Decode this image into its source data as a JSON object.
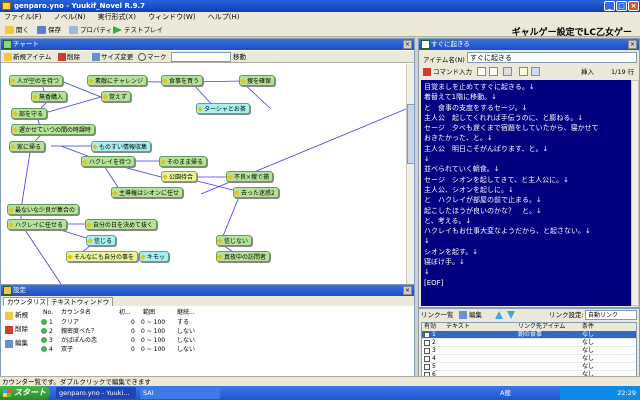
{
  "window": {
    "title": "genparo.yno - Yuukif_Novel R.9.7"
  },
  "menu": [
    "ファイル(F)",
    "ノベル(N)",
    "実行形式(X)",
    "ウィンドウ(W)",
    "ヘルプ(H)"
  ],
  "toolbar": [
    "開く",
    "保存",
    "プロパティ",
    "テストプレイ"
  ],
  "brand": "ギャルゲー設定でLC乙女ゲー",
  "chart": {
    "title": "チャート",
    "tools": [
      "新規アイテム",
      "削除",
      "サイズ変更",
      "マーク",
      "移動"
    ],
    "nodes": [
      {
        "label": "人が空のを待つ"
      },
      {
        "label": "素敵にチャレンジ"
      },
      {
        "label": "食事を買う"
      },
      {
        "label": "捜を確保"
      },
      {
        "label": "無香購入"
      },
      {
        "label": "覚えず"
      },
      {
        "label": "ターシャとお茶"
      },
      {
        "label": "部を守る"
      },
      {
        "label": "遅かせていつの間の時課時"
      },
      {
        "label": "家に帰る"
      },
      {
        "label": "ものすい情報収集"
      },
      {
        "label": "ハクレイを待つ"
      },
      {
        "label": "そのまま帰る"
      },
      {
        "label": "公園待合"
      },
      {
        "label": "不良×捜で捕"
      },
      {
        "label": "主導権はシオンに任せ"
      },
      {
        "label": "去った迷惑2"
      },
      {
        "label": "最ないな少良が集合の"
      },
      {
        "label": "ハクレイに任せる"
      },
      {
        "label": "自分の日を決めて抜く"
      },
      {
        "label": "信じる"
      },
      {
        "label": "信じない"
      },
      {
        "label": "そんなにも自分の事を"
      },
      {
        "label": "キモッ"
      },
      {
        "label": "真夜中の訪問者"
      }
    ]
  },
  "variables": {
    "title": "設定",
    "tabs": [
      "カウンタリスト",
      "テキストウィンドウ"
    ],
    "buttons": [
      "新規",
      "削除",
      "編集"
    ],
    "headers": [
      "No.",
      "カウンタ名",
      "初...",
      "範囲",
      "継続..."
    ],
    "rows": [
      {
        "no": "1",
        "name": "クリア",
        "init": "0",
        "range": "0 ~ 100",
        "keep": "する"
      },
      {
        "no": "2",
        "name": "親密度ベた？",
        "init": "0",
        "range": "0 ~ 100",
        "keep": "しない"
      },
      {
        "no": "3",
        "name": "かばぽんの恋",
        "init": "0",
        "range": "0 ~ 100",
        "keep": "しない"
      },
      {
        "no": "4",
        "name": "双子",
        "init": "0",
        "range": "0 ~ 100",
        "keep": "しない"
      }
    ]
  },
  "event": {
    "title": "すぐに起きる",
    "name_label": "アイテム名(N)",
    "name_value": "すぐに起きる",
    "command_btn": "コマンド入力",
    "insert_label": "挿入",
    "page": "1/19 行",
    "text": "目覚ましを止めてすぐに起きる。↓\n着替えて1階に移動。↓\nと　食事の支度をするセージ。↓\n主人公　起してくれれば手伝うのに、と膨ねる。↓\nセージ　夕べも遅くまで宿題をしていたから、寝かせて\nおきたかった、と。↓\n主人公　明日こそがんばります、と。↓\n↓\n並べられていく朝食。↓\nセージ　シオンを起してきて、と主人公に。↓\n主人公、シオンを起しに。↓\nと　ハクレイが部屋の前で止まる。↓\n起こしたほうが良いのかな？　と。↓\nと、考える。↓\nハクレイもお仕事大変なようだから、と起さない。↓\n↓\nシオンを起す。↓\n寝ぼけ手。↓\n↓",
    "eof": "[EOF]"
  },
  "links": {
    "title": "リンク一覧",
    "edit_btn": "編集",
    "setting_label": "リンク設定:",
    "setting_value": "自動リンク",
    "headers": [
      "有効",
      "テキスト",
      "リンク先アイテム",
      "条件"
    ],
    "rows": [
      {
        "n": "1",
        "text": "",
        "target": "朝の食事",
        "cond": "なし",
        "selected": true
      },
      {
        "n": "2",
        "text": "",
        "target": "",
        "cond": "なし",
        "selected": false
      },
      {
        "n": "3",
        "text": "",
        "target": "",
        "cond": "なし",
        "selected": false
      },
      {
        "n": "4",
        "text": "",
        "target": "",
        "cond": "なし",
        "selected": false
      },
      {
        "n": "5",
        "text": "",
        "target": "",
        "cond": "なし",
        "selected": false
      },
      {
        "n": "6",
        "text": "",
        "target": "",
        "cond": "なし",
        "selected": false
      }
    ]
  },
  "status": "カウンター覧です。ダブルクリックで編集できます",
  "taskbar": {
    "start": "スタート",
    "tasks": [
      "genparo.yno - Yuuki...",
      "SAI"
    ],
    "clock": "22:29",
    "ime": "A般"
  }
}
